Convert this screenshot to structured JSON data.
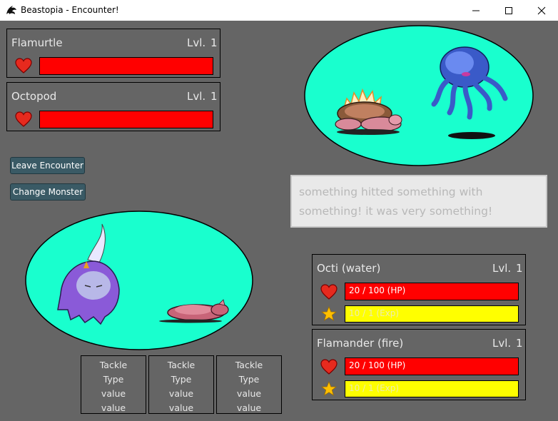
{
  "window": {
    "title": "Beastopia - Encounter!",
    "app_icon": "dragon-icon",
    "controls": [
      "minimize-icon",
      "maximize-icon",
      "close-icon"
    ]
  },
  "enemies": [
    {
      "name": "Flamurtle",
      "lvl_label": "Lvl.",
      "level": "1",
      "hp_fraction": 1.0
    },
    {
      "name": "Octopod",
      "lvl_label": "Lvl.",
      "level": "1",
      "hp_fraction": 1.0
    }
  ],
  "buttons": {
    "leave": "Leave Encounter",
    "change": "Change Monster"
  },
  "battle_log": "something hitted something with something! it was very something!",
  "team": [
    {
      "name": "Octi (water)",
      "lvl_label": "Lvl.",
      "level": "1",
      "hp_text": "20 / 100 (HP)",
      "exp_text": "10 / 1 (Exp)",
      "hp_fraction": 1.0,
      "exp_fraction": 1.0
    },
    {
      "name": "Flamander (fire)",
      "lvl_label": "Lvl.",
      "level": "1",
      "hp_text": "20 / 100 (HP)",
      "exp_text": "10 / 1 (Exp)",
      "hp_fraction": 1.0,
      "exp_fraction": 1.0
    }
  ],
  "moves": [
    {
      "name": "Tackle",
      "type": "Type",
      "value1": "value",
      "value2": "value"
    },
    {
      "name": "Tackle",
      "type": "Type",
      "value1": "value",
      "value2": "value"
    },
    {
      "name": "Tackle",
      "type": "Type",
      "value1": "value",
      "value2": "value"
    }
  ],
  "colors": {
    "background": "#656565",
    "arena": "#19ffce",
    "hp": "#ff0000",
    "exp": "#ffff00",
    "button": "#3a5a65"
  },
  "icons": {
    "health": "heart-icon",
    "experience": "star-icon"
  }
}
